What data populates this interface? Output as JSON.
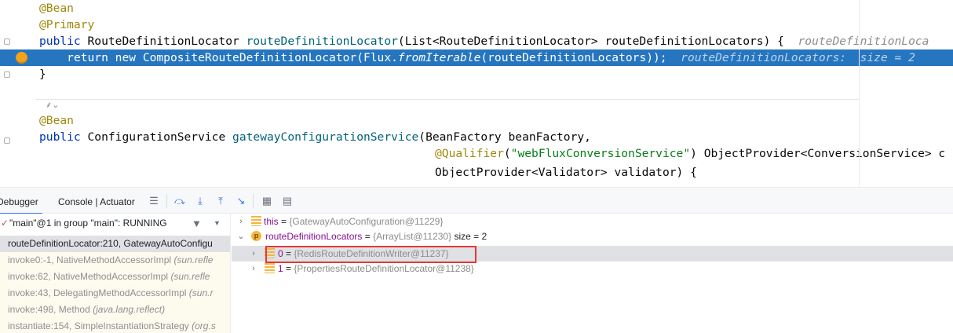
{
  "editor": {
    "lines": [
      {
        "annotation": "@Bean"
      },
      {
        "annotation": "@Primary"
      },
      {
        "kw_public": "public",
        "type": "RouteDefinitionLocator",
        "method": "routeDefinitionLocator",
        "params": "(List<RouteDefinitionLocator> routeDefinitionLocators) {",
        "inlay": "routeDefinitionLoca"
      },
      {
        "kw_return": "return",
        "kw_new": "new",
        "ctor": "CompositeRouteDefinitionLocator(Flux.",
        "call": "fromIterable",
        "args": "(routeDefinitionLocators));",
        "inlay": "routeDefinitionLocators:  size = 2"
      },
      {
        "text": "}"
      },
      {
        "annotation": "@Bean"
      },
      {
        "kw_public": "public",
        "type": "ConfigurationService",
        "method": "gatewayConfigurationService",
        "params": "(BeanFactory beanFactory,"
      },
      {
        "annotation": "@Qualifier",
        "open": "(",
        "string": "\"webFluxConversionService\"",
        "rest": ") ObjectProvider<ConversionService> c"
      },
      {
        "text": "ObjectProvider<Validator> validator) {"
      }
    ],
    "fold_hint": "⸙⌄"
  },
  "debugger": {
    "tabs": [
      "Debugger",
      "Console | Actuator"
    ],
    "toolbar_icons": [
      "menu-icon",
      "step-over-icon",
      "step-into-icon",
      "step-out-icon",
      "run-to-cursor-icon",
      "table-icon",
      "evaluate-icon"
    ],
    "thread": "\"main\"@1 in group \"main\": RUNNING",
    "frames": [
      {
        "method": "routeDefinitionLocator:210, GatewayAutoConfigu",
        "pkg": ""
      },
      {
        "method": "invoke0:-1, NativeMethodAccessorImpl ",
        "pkg": "(sun.refle"
      },
      {
        "method": "invoke:62, NativeMethodAccessorImpl ",
        "pkg": "(sun.refle"
      },
      {
        "method": "invoke:43, DelegatingMethodAccessorImpl ",
        "pkg": "(sun.r"
      },
      {
        "method": "invoke:498, Method ",
        "pkg": "(java.lang.reflect)"
      },
      {
        "method": "instantiate:154, SimpleInstantiationStrategy ",
        "pkg": "(org.s"
      }
    ],
    "variables": [
      {
        "name": "this",
        "eq": " = ",
        "value": "{GatewayAutoConfiguration@11229}",
        "extra": ""
      },
      {
        "name": "routeDefinitionLocators",
        "eq": " = ",
        "value": "{ArrayList@11230}",
        "extra": "  size = 2"
      },
      {
        "name": "0",
        "eq": " = ",
        "value": "{RedisRouteDefinitionWriter@11237}",
        "extra": ""
      },
      {
        "name": "1",
        "eq": " = ",
        "value": "{PropertiesRouteDefinitionLocator@11238}",
        "extra": ""
      }
    ],
    "param_badge": "p"
  }
}
